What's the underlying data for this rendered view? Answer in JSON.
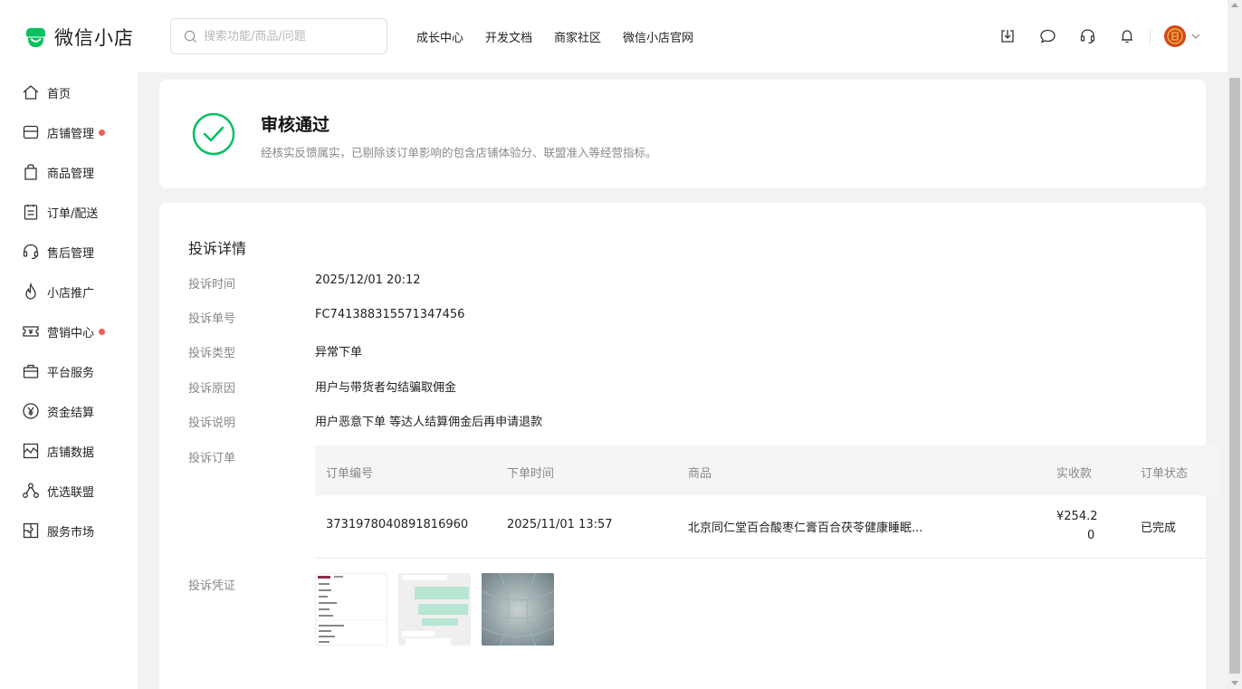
{
  "header": {
    "logo_text": "微信小店",
    "search_placeholder": "搜索功能/商品/问题",
    "nav": [
      "成长中心",
      "开发文档",
      "商家社区",
      "微信小店官网"
    ],
    "tool_icons": [
      "download-icon",
      "message-icon",
      "headset-icon",
      "bell-icon"
    ]
  },
  "sidebar": {
    "items": [
      {
        "label": "首页",
        "icon": "home-icon",
        "dot": false
      },
      {
        "label": "店铺管理",
        "icon": "store-icon",
        "dot": true
      },
      {
        "label": "商品管理",
        "icon": "bag-icon",
        "dot": false
      },
      {
        "label": "订单/配送",
        "icon": "order-icon",
        "dot": false
      },
      {
        "label": "售后管理",
        "icon": "headset-icon",
        "dot": false
      },
      {
        "label": "小店推广",
        "icon": "flame-icon",
        "dot": false
      },
      {
        "label": "营销中心",
        "icon": "ticket-icon",
        "dot": true
      },
      {
        "label": "平台服务",
        "icon": "briefcase-icon",
        "dot": false
      },
      {
        "label": "资金结算",
        "icon": "yuan-icon",
        "dot": false
      },
      {
        "label": "店铺数据",
        "icon": "chart-icon",
        "dot": false
      },
      {
        "label": "优选联盟",
        "icon": "network-icon",
        "dot": false
      },
      {
        "label": "服务市场",
        "icon": "puzzle-icon",
        "dot": false
      }
    ],
    "dot_color": "#f25b5b"
  },
  "status": {
    "title": "审核通过",
    "desc": "经核实反馈属实，已剔除该订单影响的包含店铺体验分、联盟准入等经营指标。",
    "color": "#07c160"
  },
  "detail": {
    "title": "投诉详情",
    "fields": [
      {
        "label": "投诉时间",
        "value": "2025/12/01 20:12"
      },
      {
        "label": "投诉单号",
        "value": "FC741388315571347456"
      },
      {
        "label": "投诉类型",
        "value": "异常下单"
      },
      {
        "label": "投诉原因",
        "value": "用户与带货者勾结骗取佣金"
      },
      {
        "label": "投诉说明",
        "value": "用户恶意下单 等达人结算佣金后再申请退款"
      }
    ],
    "order_label": "投诉订单",
    "evidence_label": "投诉凭证",
    "table": {
      "headers": [
        "订单编号",
        "下单时间",
        "商品",
        "实收款",
        "订单状态"
      ],
      "row": {
        "order_no": "3731978040891816960",
        "time": "2025/11/01 13:57",
        "product": "北京同仁堂百合酸枣仁膏百合茯苓健康睡眠...",
        "amount_line1": "¥254.2",
        "amount_line2": "0",
        "status": "已完成"
      }
    }
  }
}
